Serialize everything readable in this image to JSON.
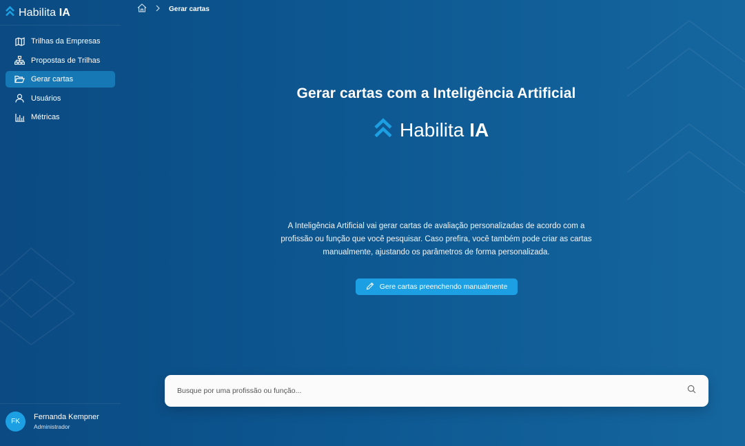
{
  "brand": {
    "name": "Habilita",
    "suffix": "IA"
  },
  "sidebar": {
    "items": [
      {
        "label": "Trilhas da Empresas",
        "icon": "map-icon",
        "active": false
      },
      {
        "label": "Propostas de Trilhas",
        "icon": "hierarchy-icon",
        "active": false
      },
      {
        "label": "Gerar cartas",
        "icon": "folder-open-icon",
        "active": true
      },
      {
        "label": "Usuários",
        "icon": "user-icon",
        "active": false
      },
      {
        "label": "Métricas",
        "icon": "bar-chart-icon",
        "active": false
      }
    ]
  },
  "user": {
    "initials": "FK",
    "name": "Fernanda Kempner",
    "role": "Administrador"
  },
  "breadcrumb": {
    "home_icon": "home-icon",
    "current": "Gerar cartas"
  },
  "main": {
    "title": "Gerar cartas com a Inteligência Artificial",
    "logo": {
      "name": "Habilita",
      "suffix": "IA"
    },
    "description": "A Inteligência Artificial vai gerar cartas de avaliação personalizadas de acordo com a profissão ou função que você pesquisar. Caso prefira, você também pode criar as cartas manualmente, ajustando os parâmetros de forma personalizada.",
    "manual_button": "Gere cartas preenchendo manualmente"
  },
  "search": {
    "placeholder": "Busque por uma profissão ou função...",
    "value": ""
  },
  "colors": {
    "accent": "#1ca0e3",
    "active_nav": "#1679b6",
    "bg_left": "#0b4a82",
    "bg_right": "#15669f"
  }
}
